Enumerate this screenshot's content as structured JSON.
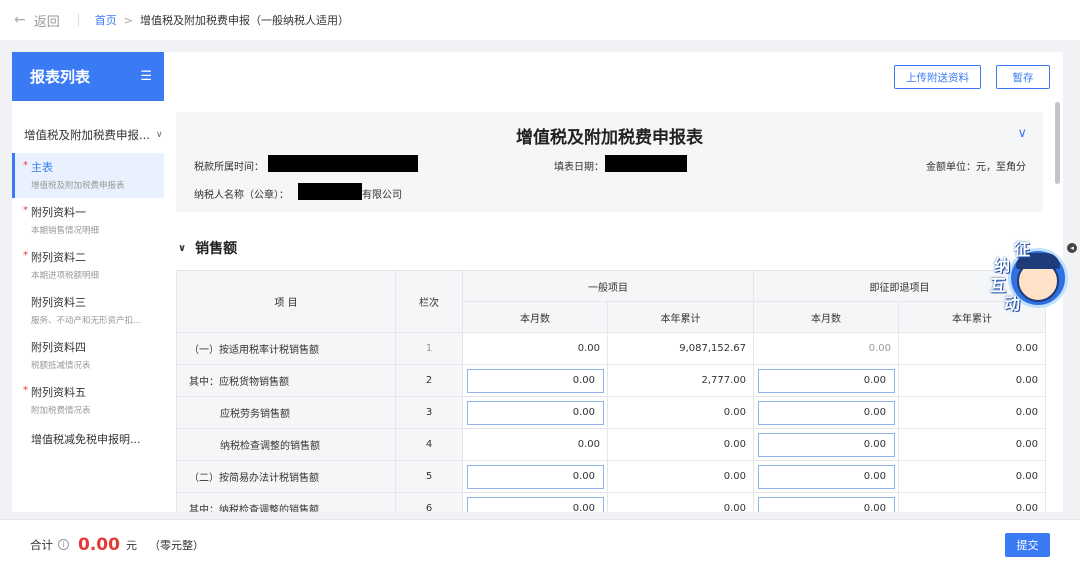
{
  "nav": {
    "back_label": "返回",
    "breadcrumb_home": "首页",
    "breadcrumb_sep": ">",
    "breadcrumb_current": "增值税及附加税费申报（一般纳税人适用）"
  },
  "sidebar": {
    "title": "报表列表",
    "group_label": "增值税及附加税费申报...",
    "items": [
      {
        "label": "主表",
        "sub": "增值税及附加税费申报表",
        "required": true,
        "active": true
      },
      {
        "label": "附列资料一",
        "sub": "本期销售情况明细",
        "required": true,
        "active": false
      },
      {
        "label": "附列资料二",
        "sub": "本期进项税额明细",
        "required": true,
        "active": false
      },
      {
        "label": "附列资料三",
        "sub": "服务、不动产和无形资产扣...",
        "required": false,
        "active": false
      },
      {
        "label": "附列资料四",
        "sub": "税额抵减情况表",
        "required": false,
        "active": false
      },
      {
        "label": "附列资料五",
        "sub": "附加税费情况表",
        "required": true,
        "active": false
      },
      {
        "label": "增值税减免税申报明...",
        "sub": "",
        "required": false,
        "active": false
      }
    ]
  },
  "actions": {
    "upload_label": "上传附送资料",
    "save_label": "暂存",
    "submit_label": "提交"
  },
  "form_header": {
    "title": "增值税及附加税费申报表",
    "period_label": "税款所属时间：",
    "fill_date_label": "填表日期：",
    "unit_label": "金额单位：元，至角分",
    "taxpayer_label": "纳税人名称（公章）：",
    "taxpayer_suffix": "有限公司"
  },
  "section": {
    "title": "销售额"
  },
  "table": {
    "header": {
      "item": "项 目",
      "col": "栏次",
      "general": "一般项目",
      "refund": "即征即退项目",
      "month": "本月数",
      "year": "本年累计"
    },
    "rows": [
      {
        "item": "（一）按适用税率计税销售额",
        "indent": 0,
        "col": "1",
        "g_month": "0.00",
        "g_year": "9,087,152.67",
        "r_month": "0.00",
        "r_year": "0.00",
        "editable": [
          false,
          false,
          false,
          false
        ],
        "grey": true
      },
      {
        "item": "其中：应税货物销售额",
        "indent": 0,
        "col": "2",
        "g_month": "0.00",
        "g_year": "2,777.00",
        "r_month": "0.00",
        "r_year": "0.00",
        "editable": [
          true,
          false,
          true,
          false
        ],
        "grey": false
      },
      {
        "item": "应税劳务销售额",
        "indent": 1,
        "col": "3",
        "g_month": "0.00",
        "g_year": "0.00",
        "r_month": "0.00",
        "r_year": "0.00",
        "editable": [
          true,
          false,
          true,
          false
        ],
        "grey": false
      },
      {
        "item": "纳税检查调整的销售额",
        "indent": 1,
        "col": "4",
        "g_month": "0.00",
        "g_year": "0.00",
        "r_month": "0.00",
        "r_year": "0.00",
        "editable": [
          false,
          false,
          true,
          false
        ],
        "grey": false
      },
      {
        "item": "（二）按简易办法计税销售额",
        "indent": 0,
        "col": "5",
        "g_month": "0.00",
        "g_year": "0.00",
        "r_month": "0.00",
        "r_year": "0.00",
        "editable": [
          true,
          false,
          true,
          false
        ],
        "grey": false
      },
      {
        "item": "其中：纳税检查调整的销售额",
        "indent": 0,
        "col": "6",
        "g_month": "0.00",
        "g_year": "0.00",
        "r_month": "0.00",
        "r_year": "0.00",
        "editable": [
          true,
          false,
          true,
          false
        ],
        "grey": false
      }
    ]
  },
  "mascot": {
    "chars": [
      "征",
      "纳",
      "互",
      "动"
    ]
  },
  "footer": {
    "total_label": "合计",
    "total_amount": "0.00",
    "currency": "元",
    "chinese_amount": "（零元整）"
  },
  "colors": {
    "primary": "#3a7bf5",
    "required_star": "#e53935",
    "total_amount": "#e53935"
  }
}
